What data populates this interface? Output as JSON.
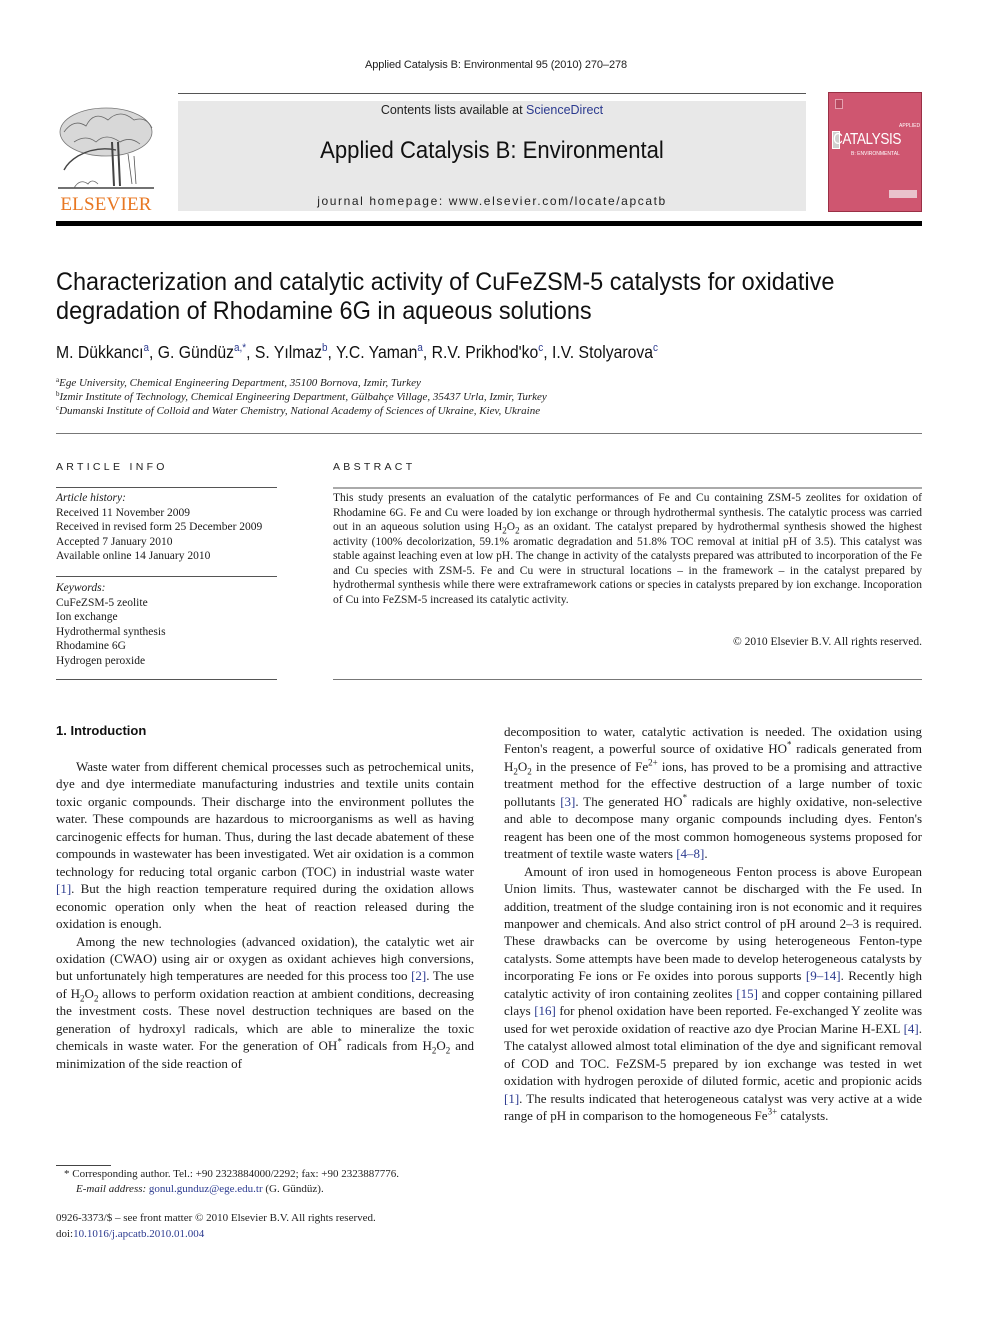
{
  "running_head": "Applied Catalysis B: Environmental 95 (2010) 270–278",
  "masthead": {
    "contents_prefix": "Contents lists available at ",
    "contents_link": "ScienceDirect",
    "journal_title": "Applied Catalysis B: Environmental",
    "homepage": "journal homepage: www.elsevier.com/locate/apcatb",
    "publisher_logo_text": "ELSEVIER",
    "cover": {
      "title": "CATALYSIS",
      "subtitle": "B: ENVIRONMENTAL",
      "volume_label": "APPLIED",
      "color": "#cf5670"
    },
    "accent_color": "#e87722",
    "link_color": "#2b3a8f"
  },
  "article": {
    "title_line1": "Characterization and catalytic activity of CuFeZSM-5 catalysts for oxidative",
    "title_line2": "degradation of Rhodamine 6G in aqueous solutions",
    "authors": [
      {
        "name": "M. Dükkancı",
        "aff": "a"
      },
      {
        "name": "G. Gündüz",
        "aff": "a,*"
      },
      {
        "name": "S. Yılmaz",
        "aff": "b"
      },
      {
        "name": "Y.C. Yaman",
        "aff": "a"
      },
      {
        "name": "R.V. Prikhod'ko",
        "aff": "c"
      },
      {
        "name": "I.V. Stolyarova",
        "aff": "c"
      }
    ],
    "affiliations": [
      {
        "key": "a",
        "text": "Ege University, Chemical Engineering Department, 35100 Bornova, Izmir, Turkey"
      },
      {
        "key": "b",
        "text": "Izmir Institute of Technology, Chemical Engineering Department, Gülbahçe Village, 35437 Urla, Izmir, Turkey"
      },
      {
        "key": "c",
        "text": "Dumanski Institute of Colloid and Water Chemistry, National Academy of Sciences of Ukraine, Kiev, Ukraine"
      }
    ]
  },
  "article_info": {
    "label": "ARTICLE INFO",
    "history_label": "Article history:",
    "history": [
      "Received 11 November 2009",
      "Received in revised form 25 December 2009",
      "Accepted 7 January 2010",
      "Available online 14 January 2010"
    ],
    "keywords_label": "Keywords:",
    "keywords": [
      "CuFeZSM-5 zeolite",
      "Ion exchange",
      "Hydrothermal synthesis",
      "Rhodamine 6G",
      "Hydrogen peroxide"
    ]
  },
  "abstract": {
    "label": "ABSTRACT",
    "text_part1": "This study presents an evaluation of the catalytic performances of Fe and Cu containing ZSM-5 zeolites for oxidation of Rhodamine 6G. Fe and Cu were loaded by ion exchange or through hydrothermal synthesis. The catalytic process was carried out in an aqueous solution using H",
    "text_part2": " as an oxidant. The catalyst prepared by hydrothermal synthesis showed the highest activity (100% decolorization, 59.1% aromatic degradation and 51.8% TOC removal at initial pH of 3.5). This catalyst was stable against leaching even at low pH. The change in activity of the catalysts prepared was attributed to incorporation of the Fe and Cu species with ZSM-5. Fe and Cu were in structural locations – in the framework – in the catalyst prepared by hydrothermal synthesis while there were extraframework cations or species in catalysts prepared by ion exchange. Incoporation of Cu into FeZSM-5 increased its catalytic activity.",
    "copyright": "© 2010 Elsevier B.V. All rights reserved."
  },
  "introduction": {
    "heading": "1.  Introduction",
    "p1a": "Waste water from different chemical processes such as petrochemical units, dye and dye intermediate manufacturing industries and textile units contain toxic organic compounds. Their discharge into the environment pollutes the water. These compounds are hazardous to microorganisms as well as having carcinogenic effects for human. Thus, during the last decade abatement of these compounds in wastewater has been investigated. Wet air oxidation is a common technology for reducing total organic carbon (TOC) in industrial waste water ",
    "ref1": "[1]",
    "p1b": ". But the high reaction temperature required during the oxidation allows economic operation only when the heat of reaction released during the oxidation is enough.",
    "p2a": "Among the new technologies (advanced oxidation), the catalytic wet air oxidation (CWAO) using air or oxygen as oxidant achieves high conversions, but unfortunately high temperatures are needed for this process too ",
    "ref2": "[2]",
    "p2b": ". The use of H",
    "p2c": " allows to perform oxidation reaction at ambient conditions, decreasing the investment costs. These novel destruction techniques are based on the generation of hydroxyl radicals, which are able to mineralize the toxic chemicals in waste water. For the generation of OH",
    "p2d": " radicals from H",
    "p2e": " and minimization of the side reaction of",
    "r1a": "decomposition to water, catalytic activation is needed. The oxidation using Fenton's reagent, a powerful source of oxidative HO",
    "r1b": " radicals generated from H",
    "r1c": " in the presence of Fe",
    "r1d": " ions, has proved to be a promising and attractive treatment method for the effective destruction of a large number of toxic pollutants ",
    "ref3": "[3]",
    "r1e": ". The generated HO",
    "r1f": " radicals are highly oxidative, non-selective and able to decompose many organic compounds including dyes. Fenton's reagent has been one of the most common homogeneous systems proposed for treatment of textile waste waters ",
    "ref4_8": "[4–8]",
    "r2a": "Amount of iron used in homogeneous Fenton process is above European Union limits. Thus, wastewater cannot be discharged with the Fe used. In addition, treatment of the sludge containing iron is not economic and it requires manpower and chemicals. And also strict control of pH around 2–3 is required. These drawbacks can be overcome by using heterogeneous Fenton-type catalysts. Some attempts have been made to develop heterogeneous catalysts by incorporating Fe ions or Fe oxides into porous supports ",
    "ref9_14": "[9–14]",
    "r2b": ". Recently high catalytic activity of iron containing zeolites ",
    "ref15": "[15]",
    "r2c": " and copper containing pillared clays ",
    "ref16": "[16]",
    "r2d": " for phenol oxidation have been reported. Fe-exchanged Y zeolite was used for wet peroxide oxidation of reactive azo dye Procian Marine H-EXL ",
    "ref4": "[4]",
    "r2e": ". The catalyst allowed almost total elimination of the dye and significant removal of COD and TOC. FeZSM-5 prepared by ion exchange was tested in wet oxidation with hydrogen peroxide of diluted formic, acetic and propionic acids ",
    "ref1b": "[1]",
    "r2f": ". The results indicated that heterogeneous catalyst was very active at a wide range of pH in comparison to the homogeneous Fe",
    "r2g": " catalysts.",
    "sub2": "2",
    "star": "*",
    "sup_fe2": "2+",
    "sup_fe3": "3+"
  },
  "footnote": {
    "marker": "*",
    "corresponding": " Corresponding author. Tel.: +90 2323884000/2292; fax: +90 2323887776.",
    "email_label": "E-mail address:",
    "email": "gonul.gunduz@ege.edu.tr",
    "email_suffix": " (G. Gündüz)."
  },
  "front_matter": {
    "issn_line": "0926-3373/$ – see front matter © 2010 Elsevier B.V. All rights reserved.",
    "doi_prefix": "doi:",
    "doi": "10.1016/j.apcatb.2010.01.004"
  }
}
